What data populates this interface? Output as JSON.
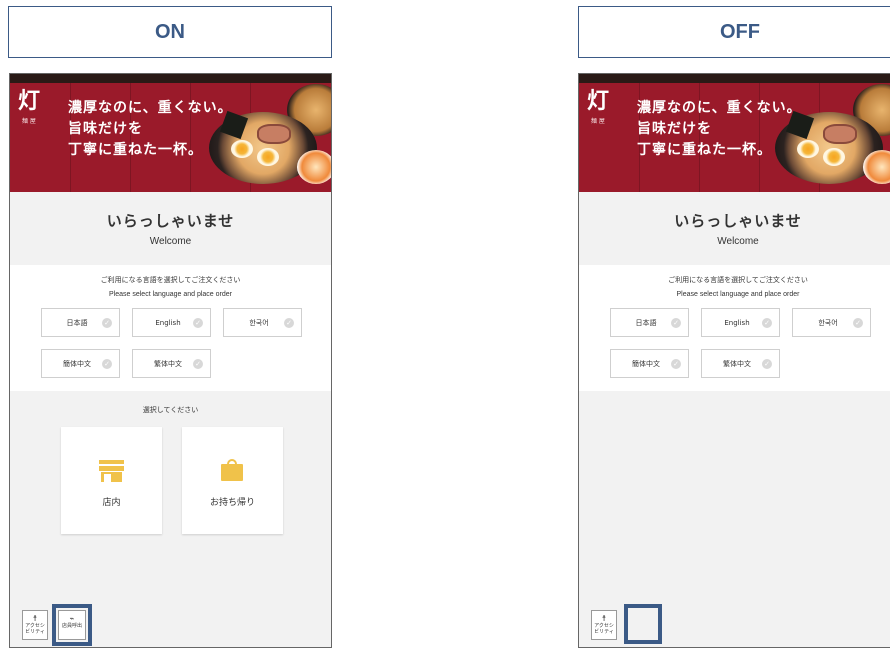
{
  "panels": {
    "on_label": "ON",
    "off_label": "OFF"
  },
  "banner": {
    "logo_char": "灯",
    "logo_sub": "麺 屋",
    "copy_line1": "濃厚なのに、重くない。",
    "copy_line2": "旨味だけを",
    "copy_line3": "丁寧に重ねた一杯。"
  },
  "welcome": {
    "jp": "いらっしゃいませ",
    "en": "Welcome"
  },
  "language": {
    "instruction_jp": "ご利用になる言語を選択してご注文ください",
    "instruction_en": "Please select language and place order",
    "options": [
      "日本語",
      "English",
      "한국어",
      "簡体中文",
      "繁体中文"
    ],
    "check_glyph": "✓"
  },
  "order_type": {
    "prompt": "選択してください",
    "dine_in": "店内",
    "takeout": "お持ち帰り"
  },
  "footer": {
    "accessibility_icon": "☨",
    "accessibility_label_1": "アクセシ",
    "accessibility_label_2": "ビリティ",
    "staff_call_icon": "⌁",
    "staff_call_label": "店員呼出"
  },
  "colors": {
    "highlight": "#3b5a86",
    "banner": "#9a1a2a",
    "accent_icon": "#f0c24a"
  }
}
